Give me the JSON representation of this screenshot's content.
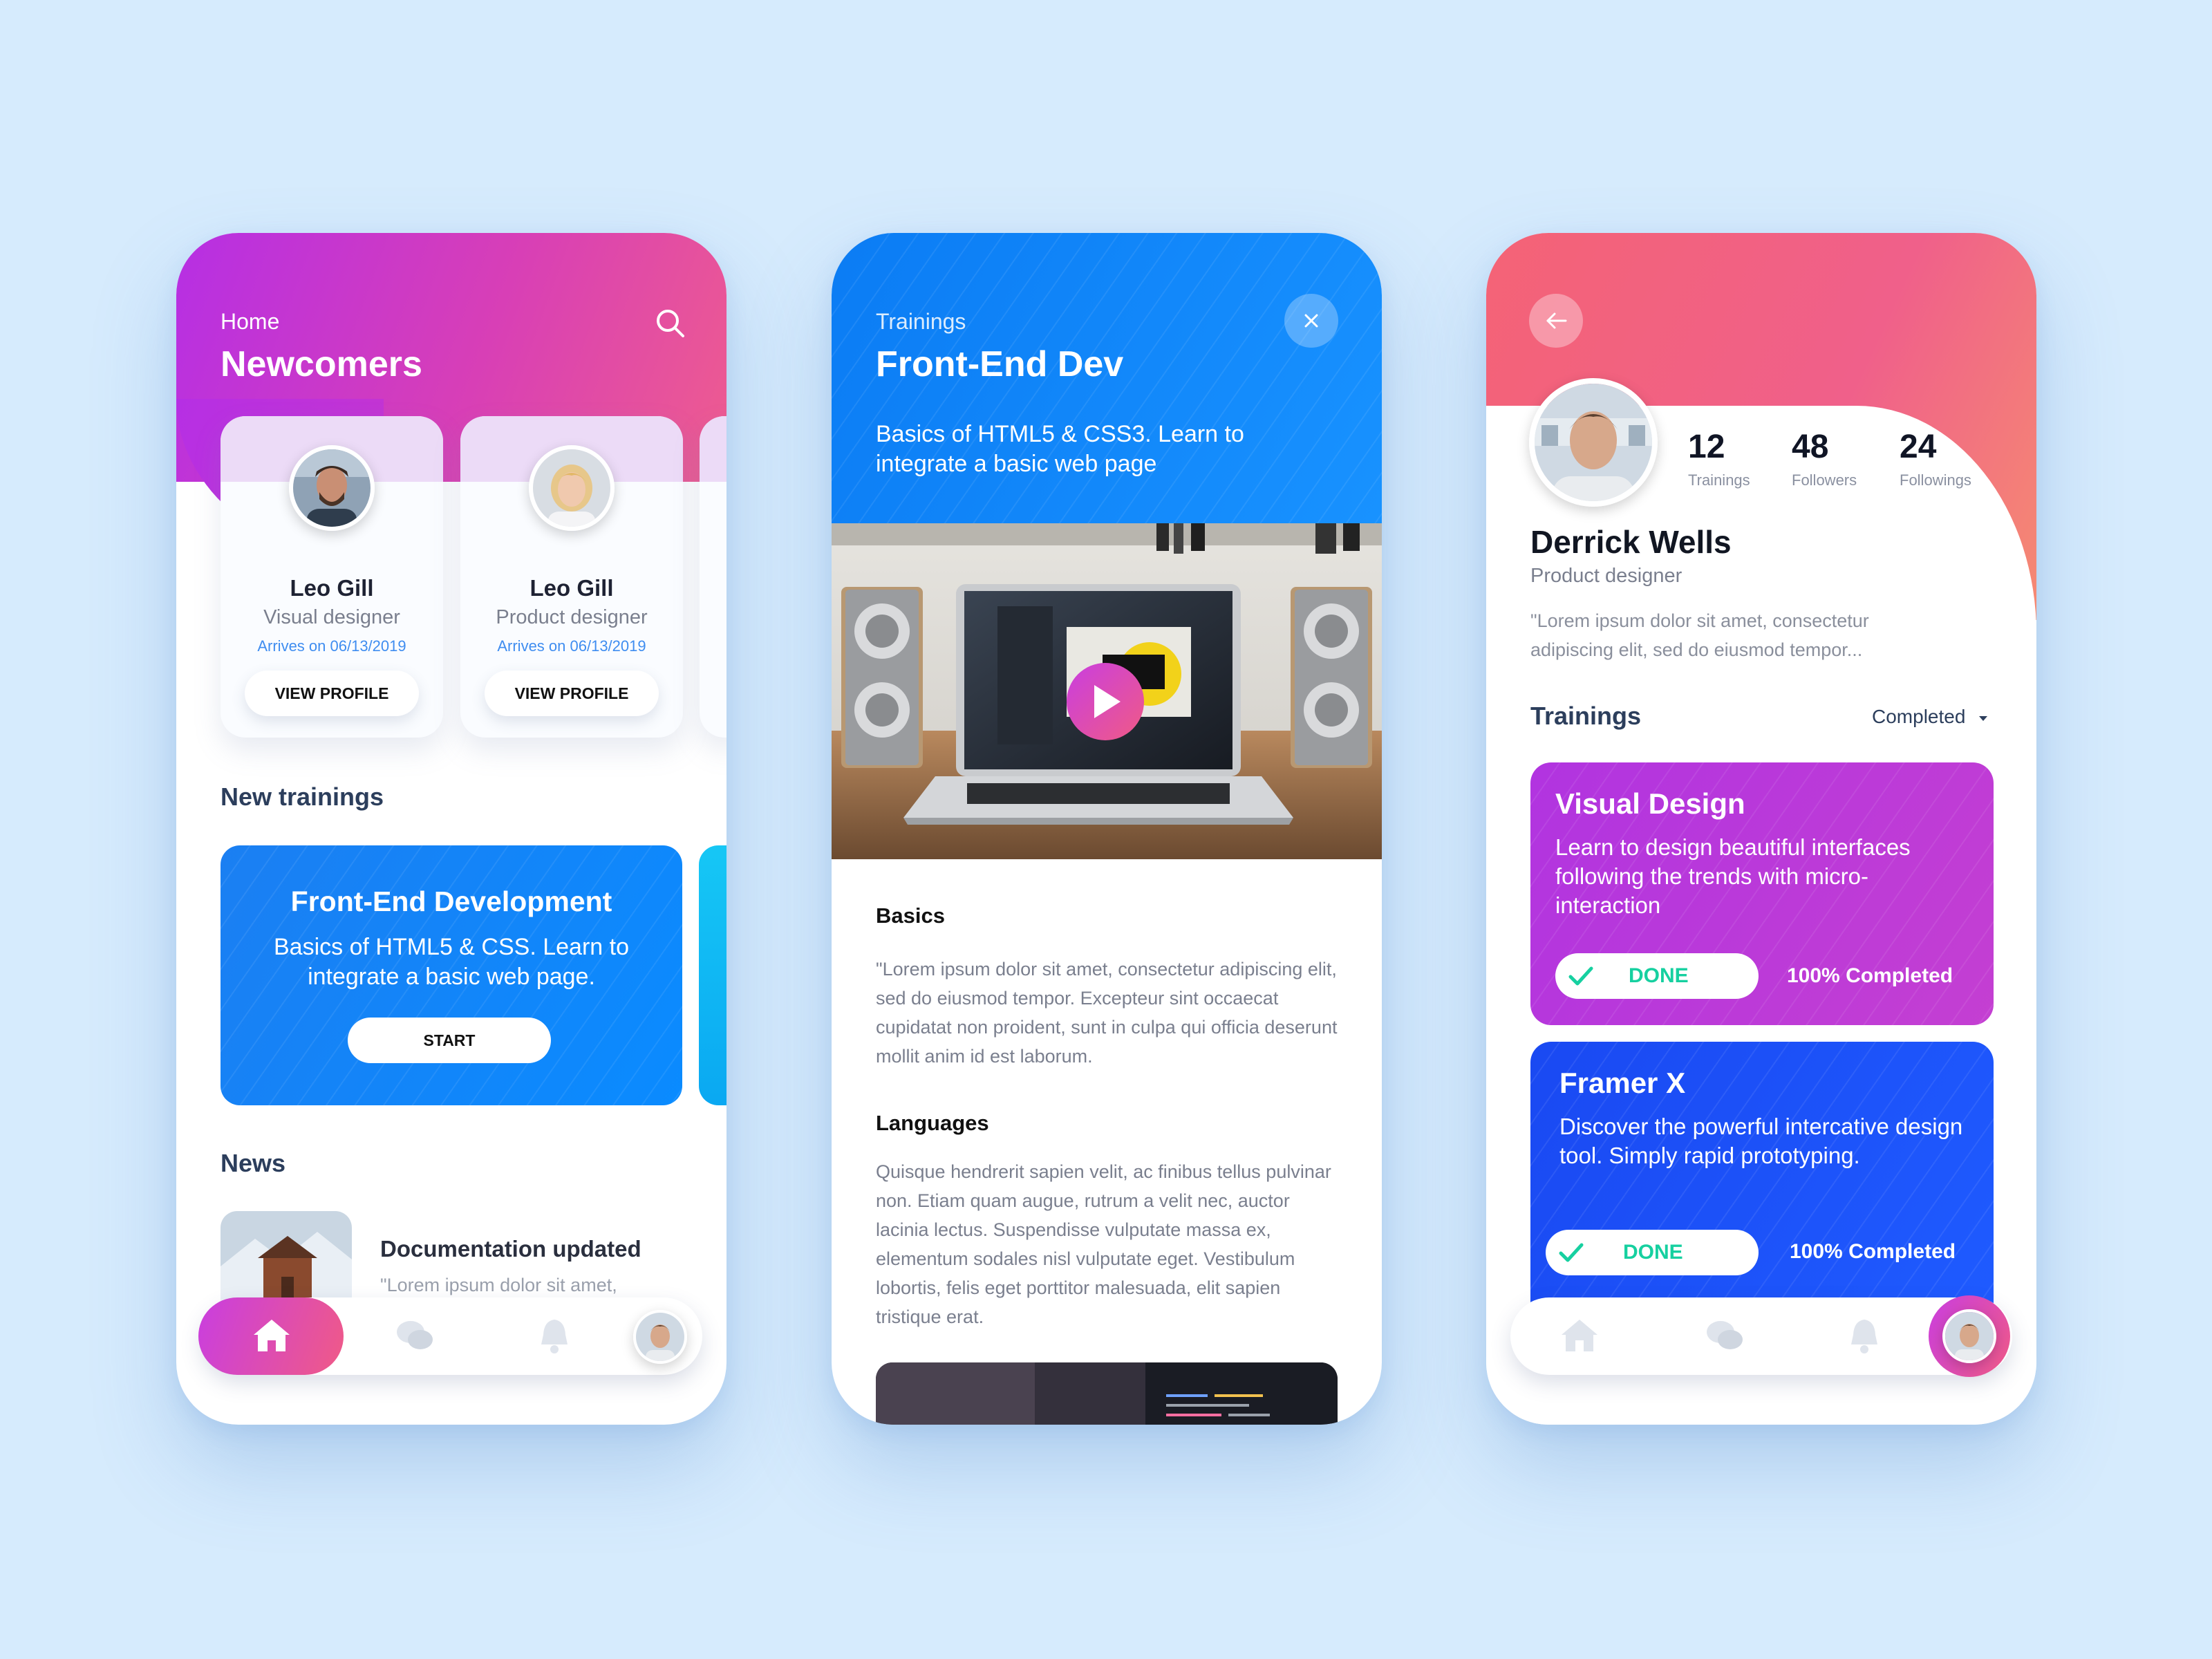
{
  "colors": {
    "background": "#d6ebfd",
    "magenta_gradient": [
      "#b62fe4",
      "#ee5c8f"
    ],
    "blue_gradient": [
      "#0b7cf4",
      "#1892ff"
    ],
    "coral_gradient": [
      "#f46376",
      "#f58a72"
    ],
    "done_green": "#16d0a0",
    "link_blue": "#3f8df0"
  },
  "home": {
    "breadcrumb": "Home",
    "title": "Newcomers",
    "newcomers": [
      {
        "name": "Leo Gill",
        "role": "Visual designer",
        "arrives": "Arrives on 06/13/2019",
        "button": "VIEW PROFILE"
      },
      {
        "name": "Leo Gill",
        "role": "Product designer",
        "arrives": "Arrives on 06/13/2019",
        "button": "VIEW PROFILE"
      }
    ],
    "new_trainings_heading": "New trainings",
    "training_card": {
      "title": "Front-End Development",
      "description": "Basics of HTML5 & CSS. Learn to integrate a basic web page.",
      "button": "START"
    },
    "news_heading": "News",
    "news_item": {
      "title": "Documentation updated",
      "excerpt": "\"Lorem ipsum dolor sit amet,"
    },
    "nav": [
      "home-icon",
      "chat-icon",
      "bell-icon",
      "profile-avatar"
    ]
  },
  "training": {
    "breadcrumb": "Trainings",
    "title": "Front-End Dev",
    "subtitle": "Basics of HTML5 & CSS3. Learn to integrate a basic web page",
    "sections": [
      {
        "heading": "Basics",
        "text": "\"Lorem ipsum dolor sit amet, consectetur adipiscing elit, sed do eiusmod tempor. Excepteur sint occaecat cupidatat non proident, sunt in culpa qui officia deserunt mollit anim id est laborum."
      },
      {
        "heading": "Languages",
        "text": "Quisque hendrerit sapien velit, ac finibus tellus pulvinar non. Etiam quam augue, rutrum a velit nec, auctor lacinia lectus. Suspendisse vulputate massa ex, elementum sodales nisl vulputate eget. Vestibulum lobortis, felis eget porttitor malesuada, elit sapien tristique erat."
      }
    ]
  },
  "profile": {
    "name": "Derrick Wells",
    "role": "Product designer",
    "bio": "\"Lorem ipsum dolor sit amet, consectetur adipiscing elit, sed do eiusmod tempor...",
    "stats": [
      {
        "value": "12",
        "label": "Trainings"
      },
      {
        "value": "48",
        "label": "Followers"
      },
      {
        "value": "24",
        "label": "Followings"
      }
    ],
    "trainings_heading": "Trainings",
    "filter": "Completed",
    "trainings": [
      {
        "title": "Visual Design",
        "description": "Learn to design beautiful interfaces following the trends with micro-interaction",
        "status": "DONE",
        "progress_label": "100% Completed",
        "progress": 1.0
      },
      {
        "title": "Framer X",
        "description": "Discover the powerful intercative design tool. Simply rapid prototyping.",
        "status": "DONE",
        "progress_label": "100% Completed",
        "progress": 1.0
      }
    ]
  }
}
